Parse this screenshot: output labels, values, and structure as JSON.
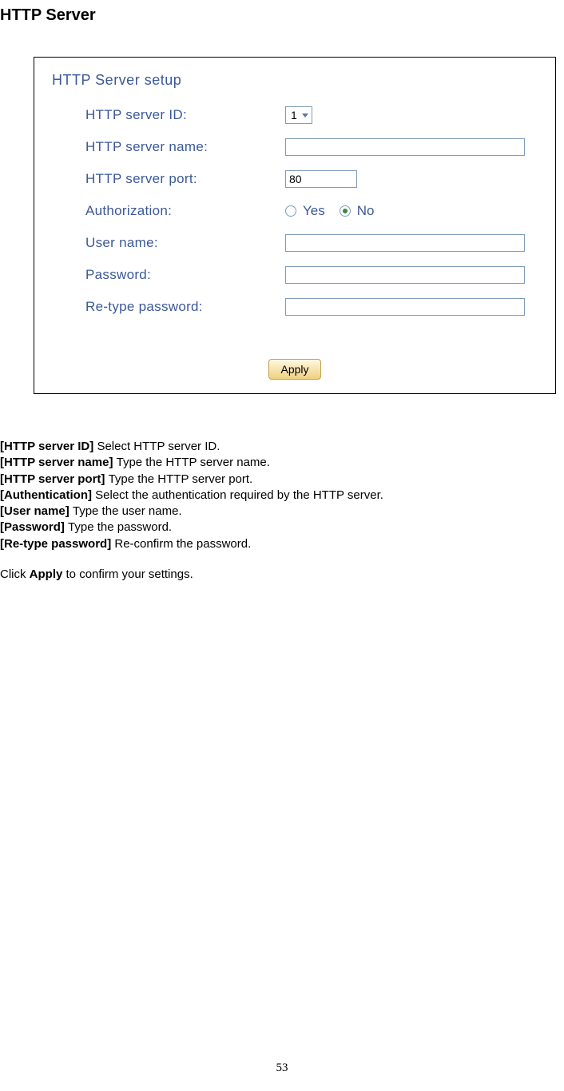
{
  "page_title": "HTTP Server",
  "form": {
    "heading": "HTTP Server setup",
    "server_id_label": "HTTP server ID:",
    "server_id_value": "1",
    "server_name_label": "HTTP server name:",
    "server_name_value": "",
    "server_port_label": "HTTP server port:",
    "server_port_value": "80",
    "auth_label": "Authorization:",
    "auth_yes": "Yes",
    "auth_no": "No",
    "user_name_label": "User name:",
    "user_name_value": "",
    "password_label": "Password:",
    "password_value": "",
    "retype_label": "Re-type password:",
    "retype_value": "",
    "apply_button": "Apply"
  },
  "desc": {
    "l1b": "[HTTP server ID] ",
    "l1": "Select HTTP server ID.",
    "l2b": "[HTTP server name] ",
    "l2": "Type the HTTP server name.",
    "l3b": "[HTTP server port] ",
    "l3": "Type the HTTP server port.",
    "l4b": "[Authentication] ",
    "l4": "Select the authentication required by the HTTP server.",
    "l5b": "[User name] ",
    "l5": "Type the user name.",
    "l6b": "[Password] ",
    "l6": "Type the password.",
    "l7b": "[Re-type password] ",
    "l7": "Re-confirm the password.",
    "l8a": "Click ",
    "l8b": "Apply",
    "l8c": " to confirm your settings."
  },
  "page_number": "53"
}
